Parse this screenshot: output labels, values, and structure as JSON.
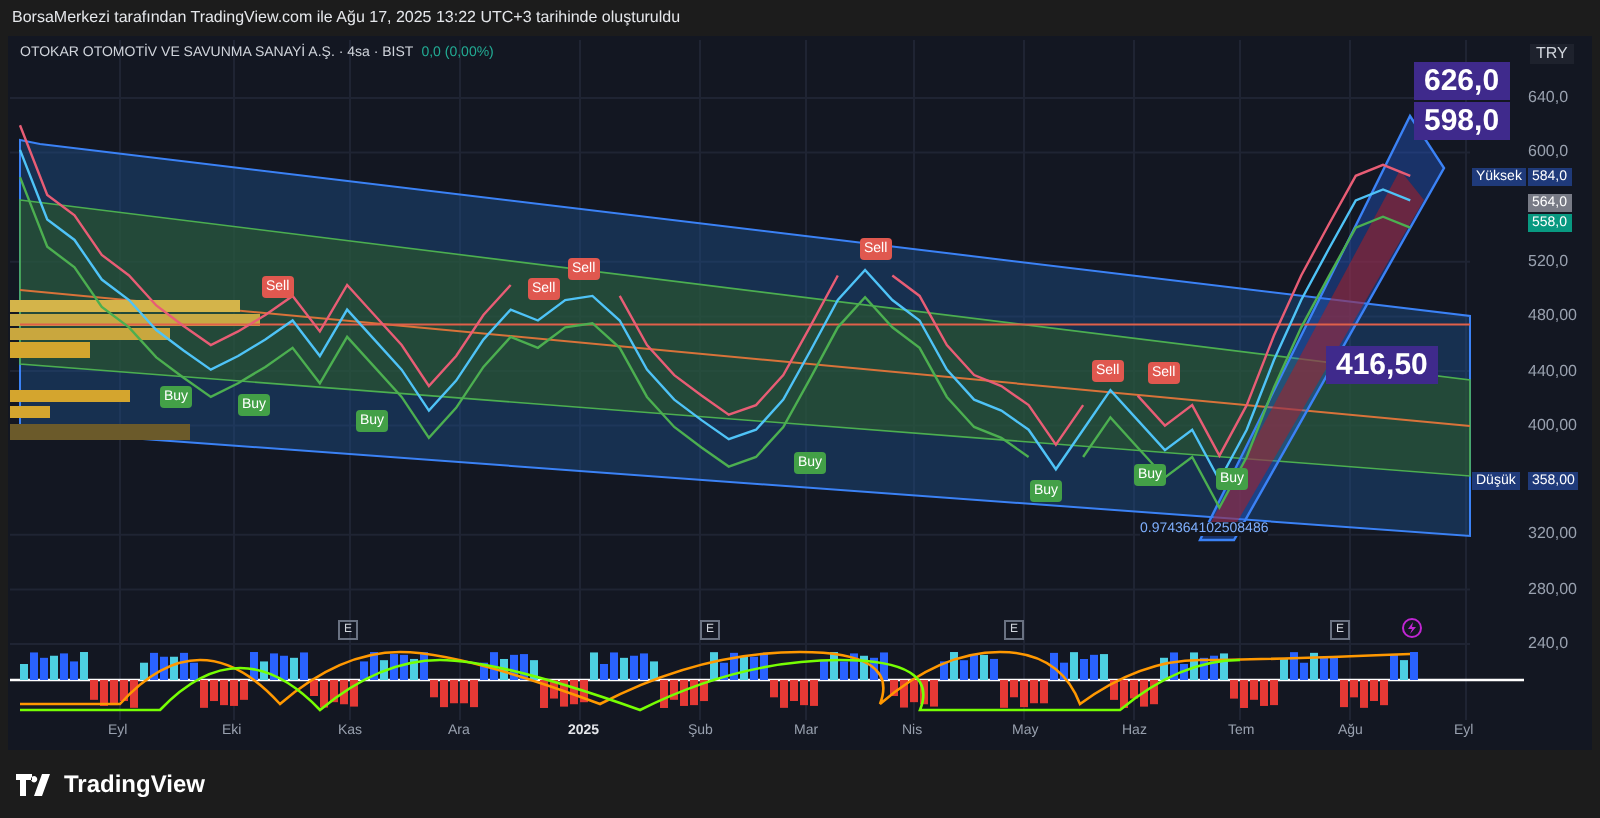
{
  "header": {
    "text": "BorsaMerkezi tarafından TradingView.com ile Ağu 17, 2025 13:22 UTC+3 tarihinde oluşturuldu"
  },
  "legend": {
    "symbol": "OTOKAR OTOMOTİV VE SAVUNMA SANAYİ A.Ş. · 4sa · BIST",
    "change": "0,0 (0,00%)"
  },
  "currency": "TRY",
  "chart_data": {
    "type": "line",
    "ylim": [
      240,
      640
    ],
    "grid": true,
    "ref_lines": [
      {
        "axis": "y",
        "value": 474,
        "color": "#e0604a"
      }
    ],
    "yticks": [
      {
        "value": 640,
        "label": "640,0"
      },
      {
        "value": 600,
        "label": "600,0"
      },
      {
        "value": 520,
        "label": "520,0"
      },
      {
        "value": 480,
        "label": "480,00"
      },
      {
        "value": 440,
        "label": "440,00"
      },
      {
        "value": 400,
        "label": "400,00"
      },
      {
        "value": 320,
        "label": "320,00"
      },
      {
        "value": 280,
        "label": "280,00"
      },
      {
        "value": 240,
        "label": "240,0"
      }
    ],
    "series": [
      {
        "color": "#4fc3f7",
        "values": [
          602,
          551,
          536,
          507,
          492,
          470,
          455,
          441,
          451,
          463,
          477,
          451,
          485,
          463,
          441,
          411,
          433,
          463,
          485,
          477,
          492,
          495,
          477,
          441,
          419,
          404,
          390,
          397,
          419,
          455,
          492,
          514,
          492,
          477,
          441,
          419,
          411,
          397,
          368,
          397,
          426,
          404,
          382,
          397,
          360,
          397,
          448,
          492,
          529,
          565,
          573,
          565
        ]
      },
      {
        "color": "#e85d75",
        "values": [
          620,
          569,
          554,
          525,
          510,
          488,
          473,
          459,
          469,
          481,
          495,
          469,
          503,
          481,
          459,
          429,
          451,
          481,
          503,
          null,
          null,
          null,
          495,
          459,
          437,
          422,
          408,
          415,
          437,
          473,
          510,
          null,
          510,
          495,
          459,
          437,
          429,
          415,
          386,
          415,
          null,
          422,
          400,
          415,
          378,
          415,
          466,
          510,
          547,
          583,
          591,
          583
        ]
      },
      {
        "color": "#4caf50",
        "values": [
          582,
          531,
          516,
          487,
          472,
          450,
          435,
          421,
          431,
          443,
          457,
          431,
          465,
          443,
          421,
          391,
          413,
          443,
          465,
          457,
          472,
          475,
          457,
          421,
          399,
          384,
          370,
          377,
          399,
          435,
          472,
          494,
          472,
          457,
          421,
          399,
          391,
          377,
          null,
          377,
          406,
          384,
          362,
          377,
          340,
          377,
          428,
          472,
          509,
          545,
          553,
          545
        ]
      }
    ]
  },
  "time_axis": [
    "Eyl",
    "Eki",
    "Kas",
    "Ara",
    "2025",
    "Şub",
    "Mar",
    "Nis",
    "May",
    "Haz",
    "Tem",
    "Ağu",
    "Eyl"
  ],
  "price_labels": [
    {
      "kind": "high",
      "label": "Yüksek",
      "value": "584,0"
    },
    {
      "kind": "last",
      "value": "564,0"
    },
    {
      "kind": "close",
      "value": "558,0"
    },
    {
      "kind": "low",
      "label": "Düşük",
      "value": "358,00"
    }
  ],
  "callouts": [
    "626,0",
    "598,0",
    "416,50"
  ],
  "signals": [
    {
      "kind": "buy",
      "label": "Buy"
    },
    {
      "kind": "buy",
      "label": "Buy"
    },
    {
      "kind": "sell",
      "label": "Sell"
    },
    {
      "kind": "buy",
      "label": "Buy"
    },
    {
      "kind": "sell",
      "label": "Sell"
    },
    {
      "kind": "sell",
      "label": "Sell"
    },
    {
      "kind": "buy",
      "label": "Buy"
    },
    {
      "kind": "sell",
      "label": "Sell"
    },
    {
      "kind": "buy",
      "label": "Buy"
    },
    {
      "kind": "sell",
      "label": "Sell"
    },
    {
      "kind": "buy",
      "label": "Buy"
    },
    {
      "kind": "sell",
      "label": "Sell"
    },
    {
      "kind": "buy",
      "label": "Buy"
    }
  ],
  "fib_label": "0.974364102508486",
  "events": [
    "E",
    "E",
    "E",
    "E"
  ],
  "footer": {
    "brand": "TradingView"
  }
}
